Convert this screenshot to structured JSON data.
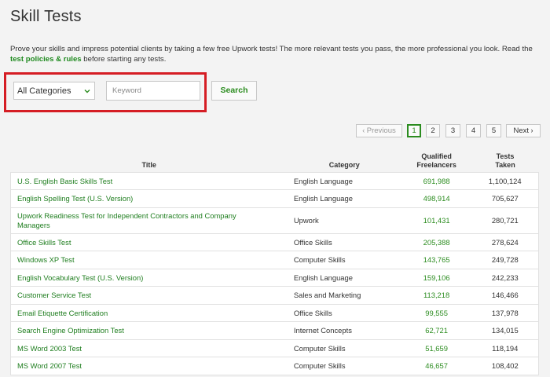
{
  "page": {
    "title": "Skill Tests",
    "intro_text": "Prove your skills and impress potential clients by taking a few free Upwork tests! The more relevant tests you pass, the more professional you look. Read the ",
    "intro_link": "test policies & rules",
    "intro_after": " before starting any tests."
  },
  "filters": {
    "category_selected": "All Categories",
    "keyword_placeholder": "Keyword",
    "search_label": "Search"
  },
  "pagination": {
    "previous_label": "Previous",
    "pages": [
      "1",
      "2",
      "3",
      "4",
      "5"
    ],
    "current_page": "1",
    "next_label": "Next"
  },
  "table": {
    "headers": {
      "title": "Title",
      "category": "Category",
      "qualified_line1": "Qualified",
      "qualified_line2": "Freelancers",
      "taken_line1": "Tests",
      "taken_line2": "Taken"
    },
    "rows": [
      {
        "title": "U.S. English Basic Skills Test",
        "category": "English Language",
        "qualified": "691,988",
        "taken": "1,100,124"
      },
      {
        "title": "English Spelling Test (U.S. Version)",
        "category": "English Language",
        "qualified": "498,914",
        "taken": "705,627"
      },
      {
        "title": "Upwork Readiness Test for Independent Contractors and Company Managers",
        "category": "Upwork",
        "qualified": "101,431",
        "taken": "280,721"
      },
      {
        "title": "Office Skills Test",
        "category": "Office Skills",
        "qualified": "205,388",
        "taken": "278,624"
      },
      {
        "title": "Windows XP Test",
        "category": "Computer Skills",
        "qualified": "143,765",
        "taken": "249,728"
      },
      {
        "title": "English Vocabulary Test (U.S. Version)",
        "category": "English Language",
        "qualified": "159,106",
        "taken": "242,233"
      },
      {
        "title": "Customer Service Test",
        "category": "Sales and Marketing",
        "qualified": "113,218",
        "taken": "146,466"
      },
      {
        "title": "Email Etiquette Certification",
        "category": "Office Skills",
        "qualified": "99,555",
        "taken": "137,978"
      },
      {
        "title": "Search Engine Optimization Test",
        "category": "Internet Concepts",
        "qualified": "62,721",
        "taken": "134,015"
      },
      {
        "title": "MS Word 2003 Test",
        "category": "Computer Skills",
        "qualified": "51,659",
        "taken": "118,194"
      },
      {
        "title": "MS Word 2007 Test",
        "category": "Computer Skills",
        "qualified": "46,657",
        "taken": "108,402"
      }
    ]
  },
  "colors": {
    "accent_green": "#2b8c1f",
    "highlight_red": "#d51d24",
    "background": "#f3f3f3"
  }
}
